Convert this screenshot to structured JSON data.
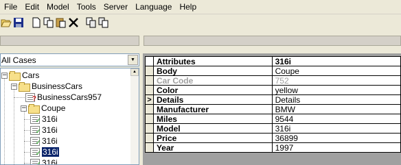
{
  "menubar": {
    "items": [
      "File",
      "Edit",
      "Model",
      "Tools",
      "Server",
      "Language",
      "Help"
    ]
  },
  "toolbar": {
    "buttons": [
      {
        "icon": "open-folder-icon"
      },
      {
        "icon": "save-icon"
      },
      {
        "icon": "new-document-icon"
      },
      {
        "icon": "copy-icon"
      },
      {
        "icon": "paste-icon"
      },
      {
        "icon": "delete-icon"
      },
      {
        "icon": "duplicate-icon"
      },
      {
        "icon": "duplicate-alt-icon"
      }
    ]
  },
  "left_pane": {
    "filter": {
      "selected": "All Cases"
    },
    "tree": {
      "root": "Cars",
      "group": "BusinessCars",
      "special_item": "BusinessCars957",
      "subgroup": "Coupe",
      "items": [
        "316i",
        "316i",
        "316i",
        "316i",
        "316i"
      ],
      "selected_index": 3
    }
  },
  "grid": {
    "header": {
      "attribute": "Attributes",
      "value": "316i"
    },
    "rows": [
      {
        "attribute": "Body",
        "value": "Coupe",
        "disabled": false,
        "current": false
      },
      {
        "attribute": "Car Code",
        "value": "752",
        "disabled": true,
        "current": false
      },
      {
        "attribute": "Color",
        "value": "yellow",
        "disabled": false,
        "current": false
      },
      {
        "attribute": "Details",
        "value": "Details",
        "disabled": false,
        "current": true
      },
      {
        "attribute": "Manufacturer",
        "value": "BMW",
        "disabled": false,
        "current": false
      },
      {
        "attribute": "Miles",
        "value": "9544",
        "disabled": false,
        "current": false
      },
      {
        "attribute": "Model",
        "value": "316i",
        "disabled": false,
        "current": false
      },
      {
        "attribute": "Price",
        "value": "36899",
        "disabled": false,
        "current": false
      },
      {
        "attribute": "Year",
        "value": "1997",
        "disabled": false,
        "current": false
      }
    ],
    "current_row_marker": ">"
  },
  "colors": {
    "window_bg": "#ece9d8",
    "selection": "#0a246a",
    "disabled_text": "#a0a0a0",
    "folder": "#f7e08a"
  }
}
